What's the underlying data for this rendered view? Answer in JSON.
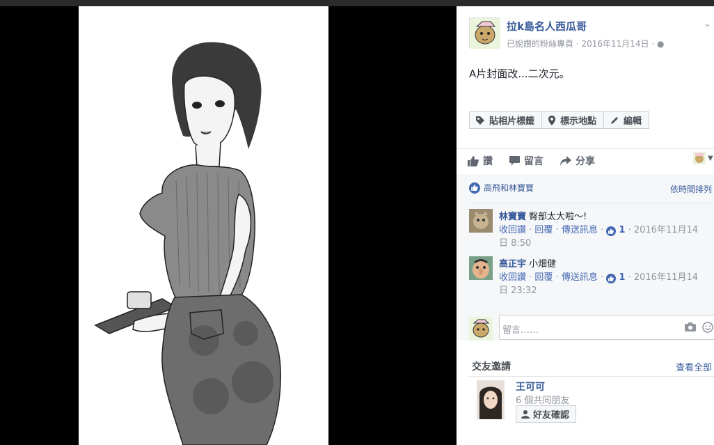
{
  "post": {
    "page_name": "拉k島名人西瓜哥",
    "page_meta": "已說讚的粉絲專頁 · 2016年11月14日 · ",
    "caption": "A片封面改...二次元。"
  },
  "tag_actions": [
    "貼相片標籤",
    "標示地點",
    "編輯"
  ],
  "actions": {
    "like": "讚",
    "comment": "留言",
    "share": "分享"
  },
  "likes": {
    "summary": "高飛和林寶寶",
    "sort_label": "依時間排列"
  },
  "comments": [
    {
      "author": "林寶寶",
      "text": "臀部太大啦～!",
      "unlike": "收回讚",
      "reply": "回覆",
      "message": "傳送訊息",
      "like_count": "1",
      "time_line1": "2016年11月14",
      "time_line2": "日 8:50"
    },
    {
      "author": "高正宇",
      "text": "小畑健",
      "unlike": "收回讚",
      "reply": "回覆",
      "message": "傳送訊息",
      "like_count": "1",
      "time_line1": "2016年11月14",
      "time_line2": "日 23:32"
    }
  ],
  "reply_input": {
    "placeholder": "留言……"
  },
  "friend_requests": {
    "title": "交友邀請",
    "see_all": "查看全部",
    "name": "王可可",
    "mutual": "6 個共同朋友",
    "confirm": "好友確認"
  },
  "colors": {
    "link": "#365899",
    "accent": "#4267b2",
    "meta": "#90949c",
    "backdrop": "#000000"
  }
}
